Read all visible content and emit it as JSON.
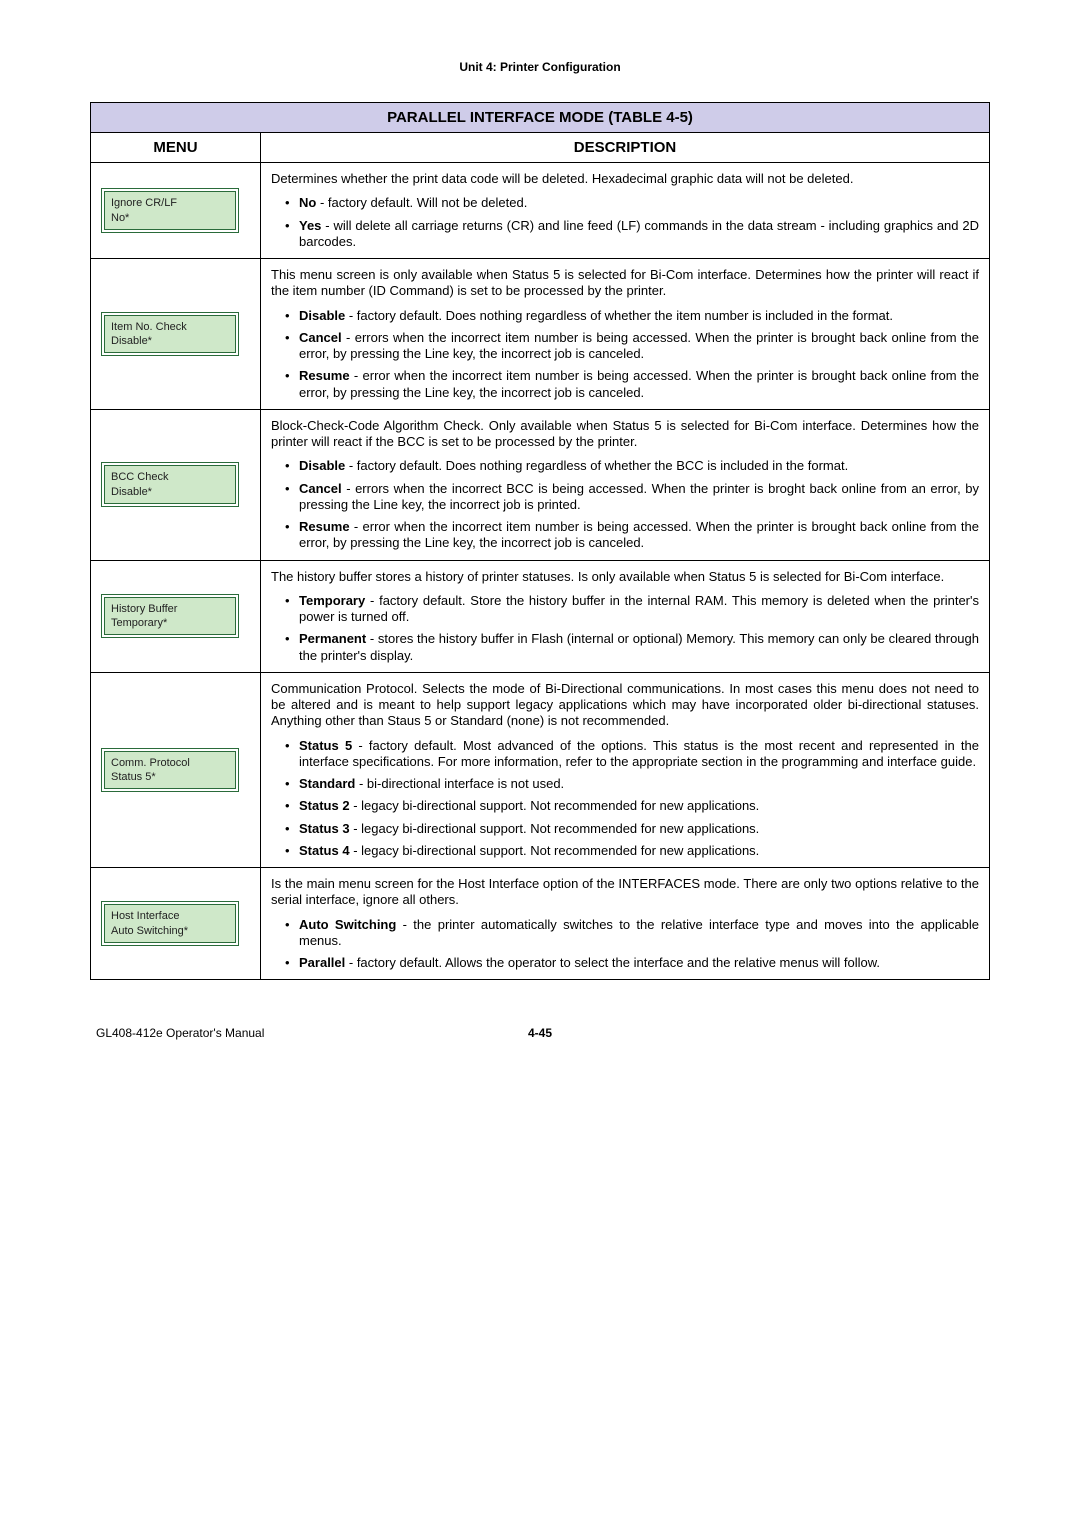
{
  "unit_header": "Unit 4:  Printer Configuration",
  "table_title": "PARALLEL INTERFACE MODE (TABLE 4-5)",
  "col_menu": "MENU",
  "col_desc": "DESCRIPTION",
  "rows": [
    {
      "menu": {
        "line1": "Ignore CR/LF",
        "line2": "No*"
      },
      "intro": "Determines whether the print data code will be deleted. Hexadecimal graphic data will not be deleted.",
      "items": [
        {
          "label": "No",
          "text": " - factory default. Will not be deleted."
        },
        {
          "label": "Yes",
          "text": " - will delete all carriage returns (CR) and line feed (LF) commands in the data stream - including graphics and 2D barcodes."
        }
      ]
    },
    {
      "menu": {
        "line1": "Item No. Check",
        "line2": "Disable*"
      },
      "intro": "This menu screen is only available when Status 5 is selected for Bi-Com interface. Determines how the printer will react if the item number (ID Command) is set to be processed by the printer.",
      "items": [
        {
          "label": "Disable",
          "text": " - factory default. Does nothing regardless of whether the item number is included in the format."
        },
        {
          "label": "Cancel",
          "text": " - errors when the incorrect item number is being accessed. When the printer is brought back online from the error, by pressing the Line key, the incorrect job is canceled."
        },
        {
          "label": "Resume",
          "text": " - error when the incorrect item number is being accessed. When the printer is brought back online from the error, by pressing the Line key, the incorrect job is canceled."
        }
      ]
    },
    {
      "menu": {
        "line1": "BCC Check",
        "line2": "Disable*"
      },
      "intro": "Block-Check-Code Algorithm Check. Only available when Status 5 is selected for Bi-Com interface. Determines how the printer will react if the BCC is set to be processed by the printer.",
      "items": [
        {
          "label": "Disable",
          "text": " - factory default. Does nothing regardless of whether the BCC is included in the format."
        },
        {
          "label": "Cancel",
          "text": " - errors when the incorrect BCC is being accessed. When the printer is broght back online from an error, by pressing the Line key, the incorrect job is printed."
        },
        {
          "label": "Resume",
          "text": " - error when the incorrect item number is being accessed. When the printer is brought back online from the error, by pressing the Line key, the incorrect job is canceled."
        }
      ]
    },
    {
      "menu": {
        "line1": "History Buffer",
        "line2": "Temporary*"
      },
      "intro": "The history buffer stores a history of printer statuses. Is only available when Status 5 is selected for Bi-Com interface.",
      "items": [
        {
          "label": "Temporary",
          "text": " - factory default. Store the history buffer in the internal RAM. This memory is deleted when the printer's power is turned off."
        },
        {
          "label": "Permanent",
          "text": " - stores the history buffer in Flash (internal or optional) Memory. This memory can only be cleared through the printer's display."
        }
      ]
    },
    {
      "menu": {
        "line1": "Comm. Protocol",
        "line2": "Status 5*"
      },
      "intro": "Communication Protocol. Selects the mode of Bi-Directional communications. In most cases this menu does not need to be altered and is meant to help support legacy applications which may have incorporated older bi-directional statuses. Anything other than Staus 5 or Standard (none) is not recommended.",
      "items": [
        {
          "label": "Status 5",
          "text": " - factory default. Most advanced of the options. This status is the most recent and represented in the interface specifications. For more information, refer to the appropriate section in the programming and interface guide."
        },
        {
          "label": "Standard",
          "text": " - bi-directional interface is not used."
        },
        {
          "label": "Status 2",
          "text": " - legacy bi-directional support. Not recommended for new applications."
        },
        {
          "label": "Status 3",
          "text": " - legacy bi-directional support. Not recommended for new applications."
        },
        {
          "label": "Status 4",
          "text": " - legacy bi-directional support. Not recommended for new applications."
        }
      ]
    },
    {
      "menu": {
        "line1": "Host Interface",
        "line2": "Auto Switching*"
      },
      "intro": "Is the main menu screen for the Host Interface option of the INTERFACES mode. There are only two options relative to the serial interface, ignore all others.",
      "items": [
        {
          "label": "Auto Switching",
          "text": " - the printer automatically switches to the relative interface type and moves into the applicable menus."
        },
        {
          "label": "Parallel",
          "text": " - factory default. Allows the operator to select the interface and the relative menus will follow."
        }
      ]
    }
  ],
  "footer_left": "GL408-412e Operator's Manual",
  "footer_page": "4-45"
}
